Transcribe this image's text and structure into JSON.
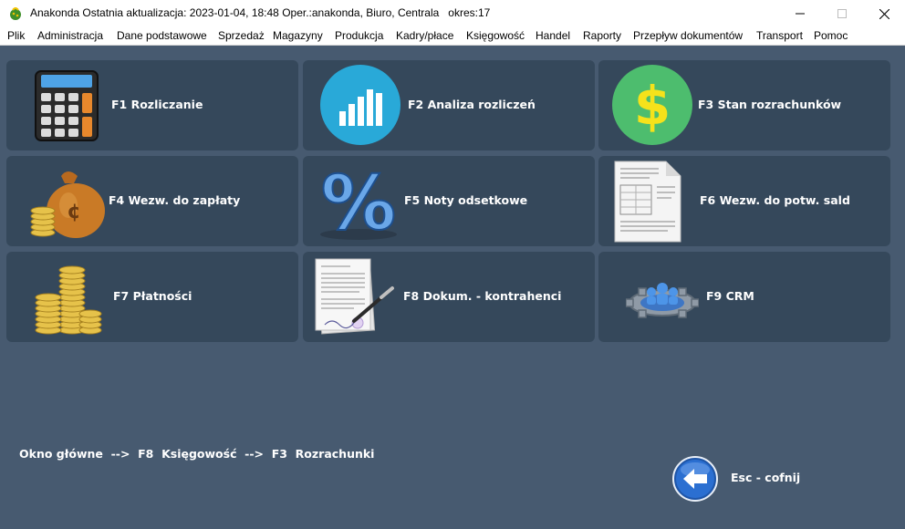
{
  "window": {
    "title": "Anakonda Ostatnia aktualizacja: 2023-01-04, 18:48 Oper.:anakonda, Biuro, Centrala   okres:17",
    "icon": "anakonda-logo-icon"
  },
  "menu": [
    {
      "label": "Plik"
    },
    {
      "label": "Administracja"
    },
    {
      "label": "Dane podstawowe"
    },
    {
      "label": "Sprzedaż"
    },
    {
      "label": "Magazyny"
    },
    {
      "label": "Produkcja"
    },
    {
      "label": "Kadry/płace"
    },
    {
      "label": "Księgowość"
    },
    {
      "label": "Handel"
    },
    {
      "label": "Raporty"
    },
    {
      "label": "Przepływ dokumentów"
    },
    {
      "label": "Transport"
    },
    {
      "label": "Pomoc"
    }
  ],
  "tiles": [
    {
      "label": "F1  Rozliczanie",
      "icon": "calculator-icon"
    },
    {
      "label": "F2  Analiza rozliczeń",
      "icon": "bar-chart-icon"
    },
    {
      "label": "F3  Stan rozrachunków",
      "icon": "dollar-icon"
    },
    {
      "label": "F4  Wezw. do zapłaty",
      "icon": "money-bag-icon"
    },
    {
      "label": "F5  Noty odsetkowe",
      "icon": "percent-icon"
    },
    {
      "label": "F6  Wezw. do potw. sald",
      "icon": "document-icon"
    },
    {
      "label": "F7  Płatności",
      "icon": "coins-icon"
    },
    {
      "label": "F8  Dokum. - kontrahenci",
      "icon": "contract-pen-icon"
    },
    {
      "label": "F9  CRM",
      "icon": "crm-gear-icon"
    }
  ],
  "breadcrumb": "Okno główne  -->  F8  Księgowość  -->  F3  Rozrachunki",
  "back": {
    "label": "Esc - cofnij",
    "icon": "back-arrow-icon"
  },
  "colors": {
    "background": "#475a70",
    "tile": "#35485b",
    "text": "#ffffff"
  }
}
